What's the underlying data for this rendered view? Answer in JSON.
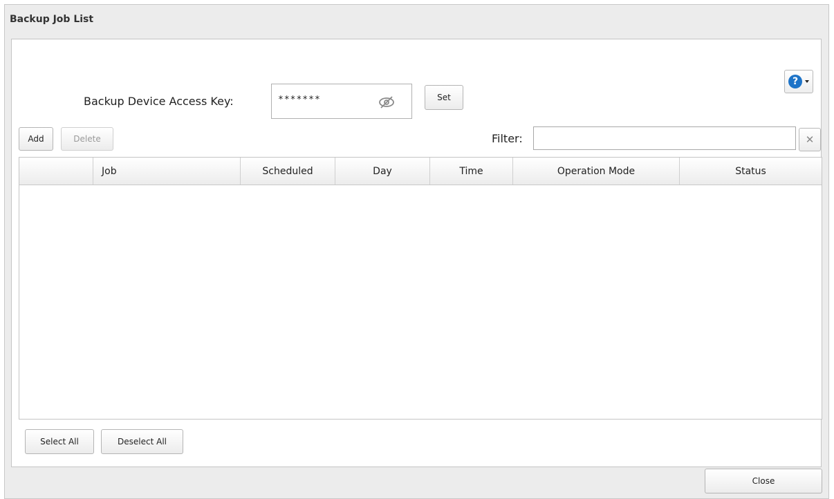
{
  "dialog": {
    "title": "Backup Job List"
  },
  "access_key": {
    "label": "Backup Device Access Key:",
    "value": "*******",
    "set_label": "Set"
  },
  "toolbar": {
    "add_label": "Add",
    "delete_label": "Delete",
    "filter_label": "Filter:",
    "filter_value": ""
  },
  "table": {
    "columns": [
      "",
      "Job",
      "Scheduled",
      "Day",
      "Time",
      "Operation Mode",
      "Status"
    ],
    "rows": []
  },
  "footer": {
    "select_all_label": "Select All",
    "deselect_all_label": "Deselect All",
    "close_label": "Close"
  },
  "icons": {
    "help": "help-icon",
    "hide_password": "eye-slash-icon",
    "clear": "close-icon"
  },
  "colors": {
    "help_accent": "#1e74c8"
  }
}
